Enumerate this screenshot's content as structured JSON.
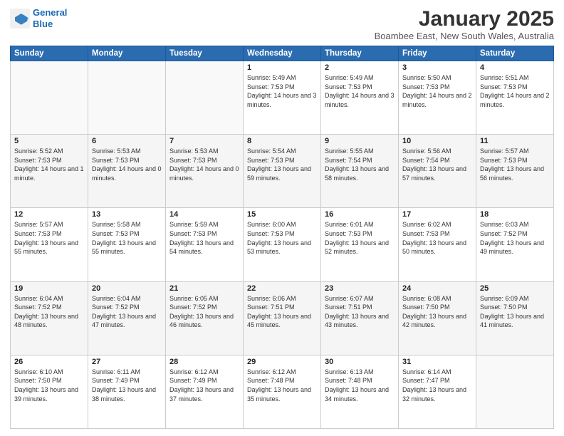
{
  "header": {
    "logo_line1": "General",
    "logo_line2": "Blue",
    "month": "January 2025",
    "location": "Boambee East, New South Wales, Australia"
  },
  "weekdays": [
    "Sunday",
    "Monday",
    "Tuesday",
    "Wednesday",
    "Thursday",
    "Friday",
    "Saturday"
  ],
  "weeks": [
    [
      {
        "day": "",
        "text": ""
      },
      {
        "day": "",
        "text": ""
      },
      {
        "day": "",
        "text": ""
      },
      {
        "day": "1",
        "text": "Sunrise: 5:49 AM\nSunset: 7:53 PM\nDaylight: 14 hours and 3 minutes."
      },
      {
        "day": "2",
        "text": "Sunrise: 5:49 AM\nSunset: 7:53 PM\nDaylight: 14 hours and 3 minutes."
      },
      {
        "day": "3",
        "text": "Sunrise: 5:50 AM\nSunset: 7:53 PM\nDaylight: 14 hours and 2 minutes."
      },
      {
        "day": "4",
        "text": "Sunrise: 5:51 AM\nSunset: 7:53 PM\nDaylight: 14 hours and 2 minutes."
      }
    ],
    [
      {
        "day": "5",
        "text": "Sunrise: 5:52 AM\nSunset: 7:53 PM\nDaylight: 14 hours and 1 minute."
      },
      {
        "day": "6",
        "text": "Sunrise: 5:53 AM\nSunset: 7:53 PM\nDaylight: 14 hours and 0 minutes."
      },
      {
        "day": "7",
        "text": "Sunrise: 5:53 AM\nSunset: 7:53 PM\nDaylight: 14 hours and 0 minutes."
      },
      {
        "day": "8",
        "text": "Sunrise: 5:54 AM\nSunset: 7:53 PM\nDaylight: 13 hours and 59 minutes."
      },
      {
        "day": "9",
        "text": "Sunrise: 5:55 AM\nSunset: 7:54 PM\nDaylight: 13 hours and 58 minutes."
      },
      {
        "day": "10",
        "text": "Sunrise: 5:56 AM\nSunset: 7:54 PM\nDaylight: 13 hours and 57 minutes."
      },
      {
        "day": "11",
        "text": "Sunrise: 5:57 AM\nSunset: 7:53 PM\nDaylight: 13 hours and 56 minutes."
      }
    ],
    [
      {
        "day": "12",
        "text": "Sunrise: 5:57 AM\nSunset: 7:53 PM\nDaylight: 13 hours and 55 minutes."
      },
      {
        "day": "13",
        "text": "Sunrise: 5:58 AM\nSunset: 7:53 PM\nDaylight: 13 hours and 55 minutes."
      },
      {
        "day": "14",
        "text": "Sunrise: 5:59 AM\nSunset: 7:53 PM\nDaylight: 13 hours and 54 minutes."
      },
      {
        "day": "15",
        "text": "Sunrise: 6:00 AM\nSunset: 7:53 PM\nDaylight: 13 hours and 53 minutes."
      },
      {
        "day": "16",
        "text": "Sunrise: 6:01 AM\nSunset: 7:53 PM\nDaylight: 13 hours and 52 minutes."
      },
      {
        "day": "17",
        "text": "Sunrise: 6:02 AM\nSunset: 7:53 PM\nDaylight: 13 hours and 50 minutes."
      },
      {
        "day": "18",
        "text": "Sunrise: 6:03 AM\nSunset: 7:52 PM\nDaylight: 13 hours and 49 minutes."
      }
    ],
    [
      {
        "day": "19",
        "text": "Sunrise: 6:04 AM\nSunset: 7:52 PM\nDaylight: 13 hours and 48 minutes."
      },
      {
        "day": "20",
        "text": "Sunrise: 6:04 AM\nSunset: 7:52 PM\nDaylight: 13 hours and 47 minutes."
      },
      {
        "day": "21",
        "text": "Sunrise: 6:05 AM\nSunset: 7:52 PM\nDaylight: 13 hours and 46 minutes."
      },
      {
        "day": "22",
        "text": "Sunrise: 6:06 AM\nSunset: 7:51 PM\nDaylight: 13 hours and 45 minutes."
      },
      {
        "day": "23",
        "text": "Sunrise: 6:07 AM\nSunset: 7:51 PM\nDaylight: 13 hours and 43 minutes."
      },
      {
        "day": "24",
        "text": "Sunrise: 6:08 AM\nSunset: 7:50 PM\nDaylight: 13 hours and 42 minutes."
      },
      {
        "day": "25",
        "text": "Sunrise: 6:09 AM\nSunset: 7:50 PM\nDaylight: 13 hours and 41 minutes."
      }
    ],
    [
      {
        "day": "26",
        "text": "Sunrise: 6:10 AM\nSunset: 7:50 PM\nDaylight: 13 hours and 39 minutes."
      },
      {
        "day": "27",
        "text": "Sunrise: 6:11 AM\nSunset: 7:49 PM\nDaylight: 13 hours and 38 minutes."
      },
      {
        "day": "28",
        "text": "Sunrise: 6:12 AM\nSunset: 7:49 PM\nDaylight: 13 hours and 37 minutes."
      },
      {
        "day": "29",
        "text": "Sunrise: 6:12 AM\nSunset: 7:48 PM\nDaylight: 13 hours and 35 minutes."
      },
      {
        "day": "30",
        "text": "Sunrise: 6:13 AM\nSunset: 7:48 PM\nDaylight: 13 hours and 34 minutes."
      },
      {
        "day": "31",
        "text": "Sunrise: 6:14 AM\nSunset: 7:47 PM\nDaylight: 13 hours and 32 minutes."
      },
      {
        "day": "",
        "text": ""
      }
    ]
  ]
}
